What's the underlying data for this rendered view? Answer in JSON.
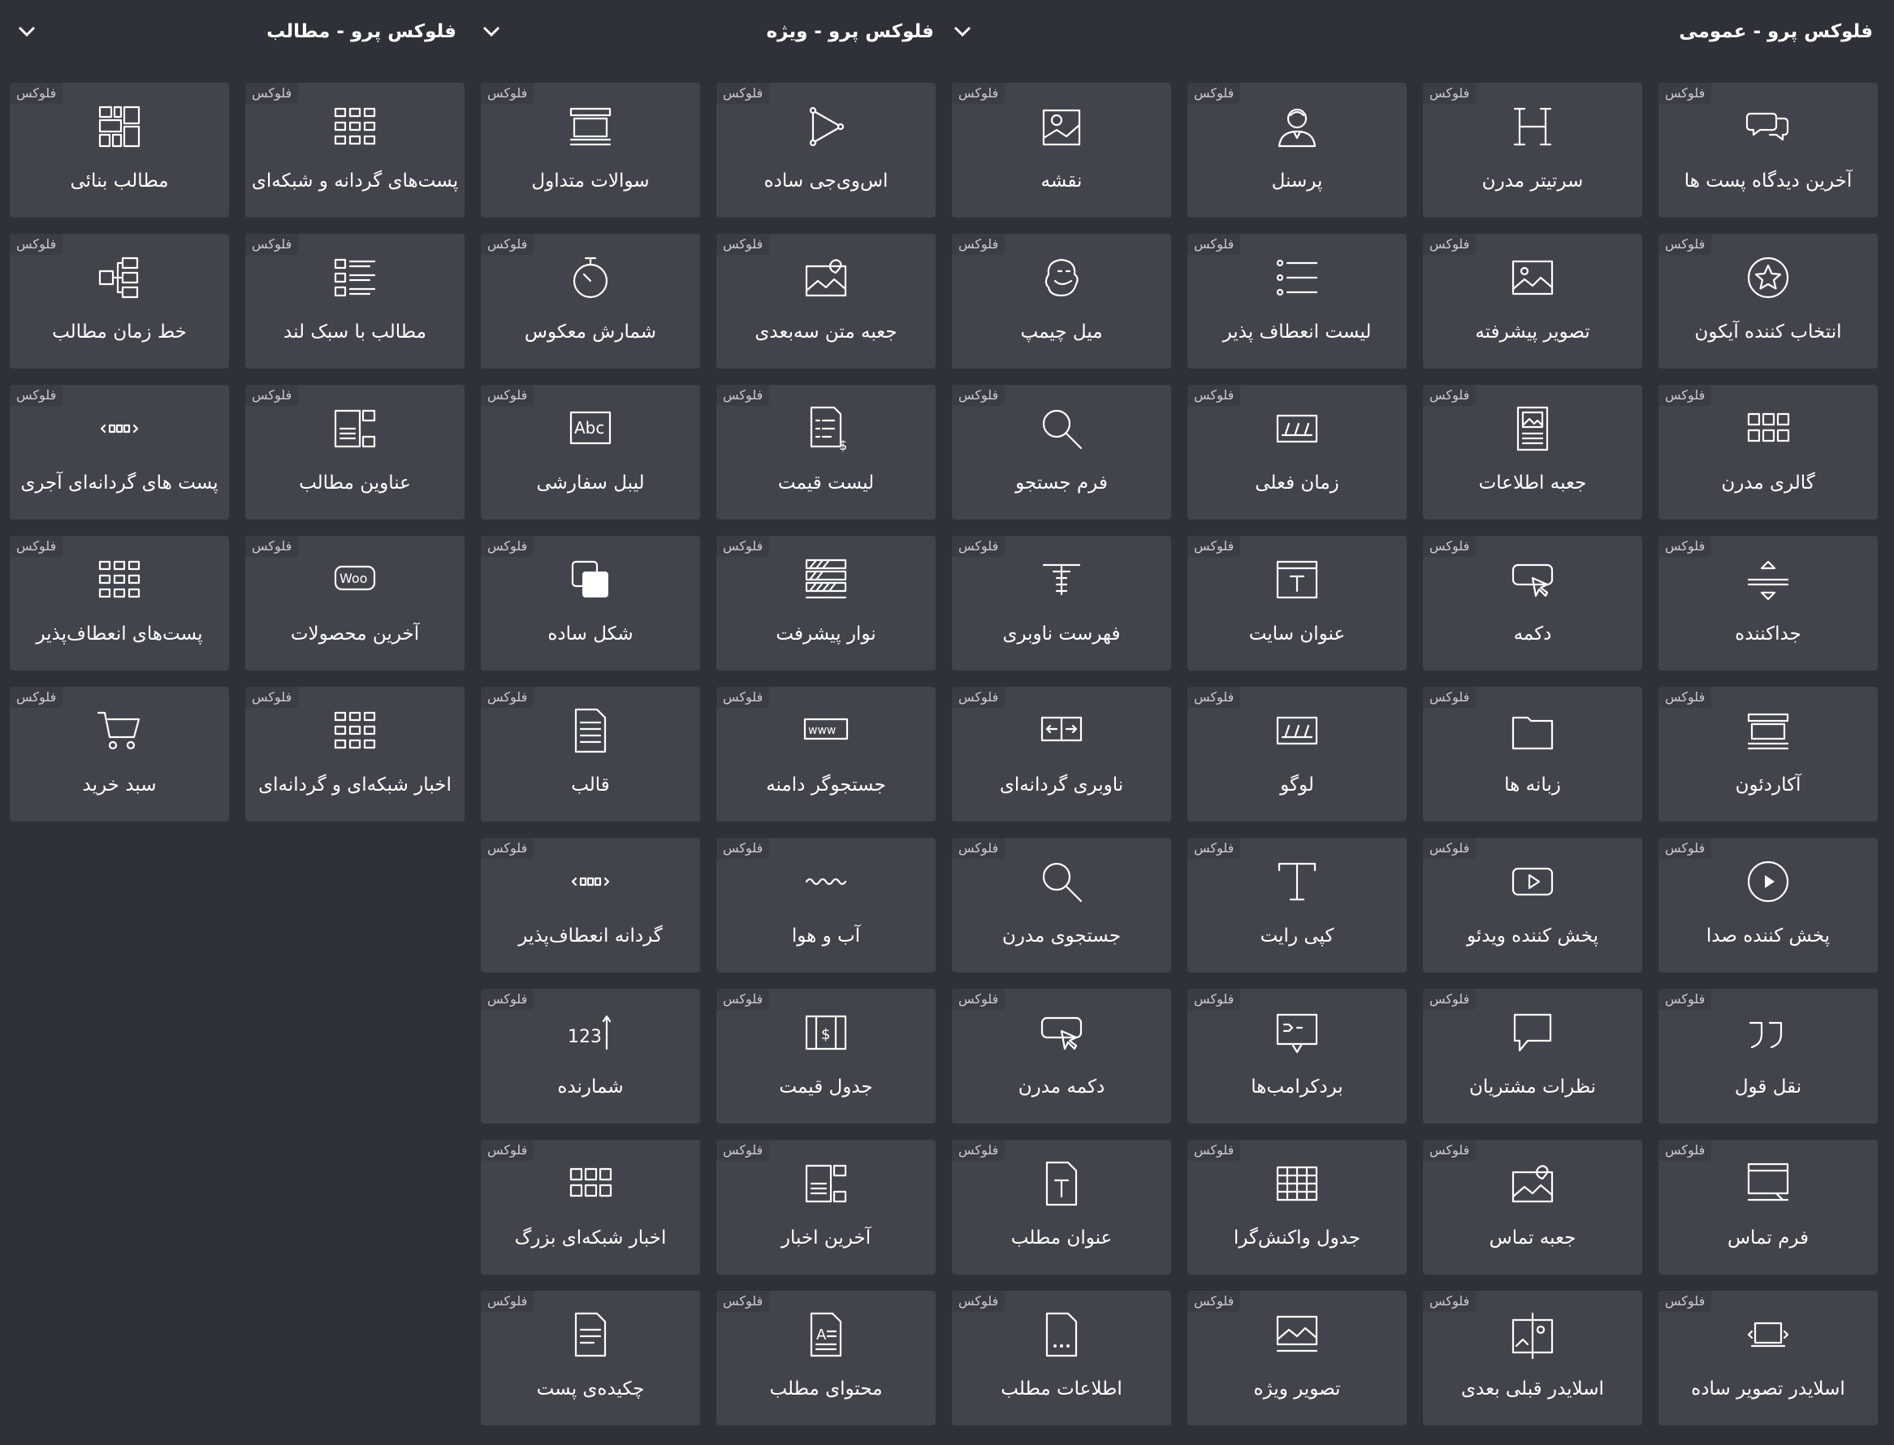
{
  "badge": "فلوکس",
  "groups": [
    {
      "title": "فلوکس پرو - عمومی"
    },
    {
      "title": "فلوکس پرو - ویژه"
    },
    {
      "title": "فلوکس پرو - مطالب"
    }
  ],
  "tiles": [
    {
      "label": "آخرین دیدگاه پست ها",
      "icon": "comments-icon"
    },
    {
      "label": "سرتیتر مدرن",
      "icon": "heading-icon"
    },
    {
      "label": "پرسنل",
      "icon": "person-icon"
    },
    {
      "label": "نقشه",
      "icon": "map-icon"
    },
    {
      "label": "اس‌وی‌جی ساده",
      "icon": "svg-vector-icon"
    },
    {
      "label": "سوالات متداول",
      "icon": "faq-accordion-icon"
    },
    {
      "label": "پست‌های گردانه و شبکه‌ای",
      "icon": "grid-icon"
    },
    {
      "label": "مطالب بنائی",
      "icon": "masonry-icon"
    },
    {
      "label": "انتخاب کننده آیکون",
      "icon": "star-circle-icon"
    },
    {
      "label": "تصویر پیشرفته",
      "icon": "image-icon"
    },
    {
      "label": "لیست انعطاف پذیر",
      "icon": "list-icon"
    },
    {
      "label": "میل چیمپ",
      "icon": "mailchimp-icon"
    },
    {
      "label": "جعبه متن سه‌بعدی",
      "icon": "image-pin-icon"
    },
    {
      "label": "شمارش معکوس",
      "icon": "stopwatch-icon"
    },
    {
      "label": "مطالب با سبک لند",
      "icon": "list-grid-icon"
    },
    {
      "label": "خط زمان مطالب",
      "icon": "timeline-icon"
    },
    {
      "label": "گالری مدرن",
      "icon": "gallery-grid-icon"
    },
    {
      "label": "جعبه اطلاعات",
      "icon": "info-box-icon"
    },
    {
      "label": "زمان فعلی",
      "icon": "date-icon"
    },
    {
      "label": "فرم جستجو",
      "icon": "search-icon"
    },
    {
      "label": "لیست قیمت",
      "icon": "price-list-icon"
    },
    {
      "label": "لیبل سفارشی",
      "icon": "abc-label-icon"
    },
    {
      "label": "عناوین مطالب",
      "icon": "post-titles-icon"
    },
    {
      "label": "پست های گردانه‌ای آجری",
      "icon": "carousel-dots-icon"
    },
    {
      "label": "جداکننده",
      "icon": "divider-icon"
    },
    {
      "label": "دکمه",
      "icon": "button-cursor-icon"
    },
    {
      "label": "عنوان سایت",
      "icon": "site-title-icon"
    },
    {
      "label": "فهرست ناوبری",
      "icon": "nav-menu-icon"
    },
    {
      "label": "نوار پیشرفت",
      "icon": "progress-bars-icon"
    },
    {
      "label": "شکل ساده",
      "icon": "shape-icon"
    },
    {
      "label": "آخرین محصولات",
      "icon": "woo-icon"
    },
    {
      "label": "پست‌های انعطاف‌پذیر",
      "icon": "grid-icon"
    },
    {
      "label": "آکاردئون",
      "icon": "accordion-icon"
    },
    {
      "label": "زبانه ها",
      "icon": "tabs-folder-icon"
    },
    {
      "label": "لوگو",
      "icon": "logo-icon"
    },
    {
      "label": "ناوبری گردانه‌ای",
      "icon": "carousel-nav-icon"
    },
    {
      "label": "جستجوگر دامنه",
      "icon": "www-icon"
    },
    {
      "label": "قالب",
      "icon": "template-doc-icon"
    },
    {
      "label": "اخبار شبکه‌ای و گردانه‌ای",
      "icon": "grid-icon"
    },
    {
      "label": "سبد خرید",
      "icon": "cart-icon"
    },
    {
      "label": "پخش کننده صدا",
      "icon": "play-circle-icon"
    },
    {
      "label": "پخش کننده ویدئو",
      "icon": "video-player-icon"
    },
    {
      "label": "کپی رایت",
      "icon": "text-t-icon"
    },
    {
      "label": "جستجوی مدرن",
      "icon": "search-icon"
    },
    {
      "label": "آب و هوا",
      "icon": "weather-wave-icon"
    },
    {
      "label": "گردانه انعطاف‌پذیر",
      "icon": "carousel-dots-icon"
    },
    {
      "label": "نقل قول",
      "icon": "quote-icon"
    },
    {
      "label": "نظرات مشتریان",
      "icon": "speech-bubble-icon"
    },
    {
      "label": "بردکرامب‌ها",
      "icon": "breadcrumb-icon"
    },
    {
      "label": "دکمه مدرن",
      "icon": "button-cursor-icon"
    },
    {
      "label": "جدول قیمت",
      "icon": "price-table-icon"
    },
    {
      "label": "شمارنده",
      "icon": "counter-icon"
    },
    {
      "label": "فرم تماس",
      "icon": "contact-form-icon"
    },
    {
      "label": "جعبه تماس",
      "icon": "image-pin-icon"
    },
    {
      "label": "جدول واکنش‌گرا",
      "icon": "table-icon"
    },
    {
      "label": "عنوان مطلب",
      "icon": "post-title-doc-icon"
    },
    {
      "label": "آخرین اخبار",
      "icon": "post-titles-icon"
    },
    {
      "label": "اخبار شبکه‌ای بزرگ",
      "icon": "gallery-grid-icon"
    },
    {
      "label": "اسلایدر تصویر ساده",
      "icon": "slider-icon"
    },
    {
      "label": "اسلایدر قبلی بعدی",
      "icon": "before-after-icon"
    },
    {
      "label": "تصویر ویژه",
      "icon": "featured-image-icon"
    },
    {
      "label": "اطلاعات مطلب",
      "icon": "post-info-doc-icon"
    },
    {
      "label": "محتوای مطلب",
      "icon": "post-content-doc-icon"
    },
    {
      "label": "چکیده‌ی پست",
      "icon": "excerpt-doc-icon"
    }
  ]
}
